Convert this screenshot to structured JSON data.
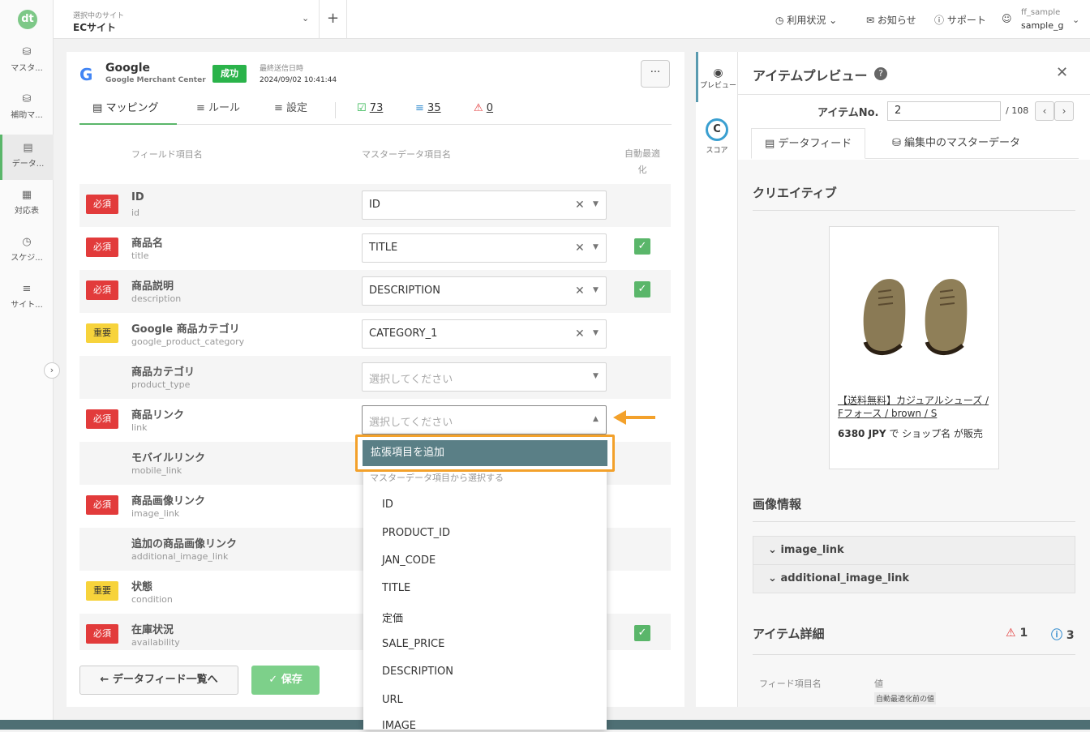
{
  "nav": {
    "logo": "dt",
    "items": [
      {
        "label": "マスタ...",
        "icon": "database-icon"
      },
      {
        "label": "補助マ...",
        "icon": "database-plus-icon"
      },
      {
        "label": "データ...",
        "icon": "document-icon"
      },
      {
        "label": "対応表",
        "icon": "table-icon"
      },
      {
        "label": "スケジ...",
        "icon": "calendar-clock-icon"
      },
      {
        "label": "サイト...",
        "icon": "sliders-icon"
      }
    ]
  },
  "topbar": {
    "site_caption": "選択中のサイト",
    "site_name": "ECサイト",
    "usage": "利用状況",
    "news": "お知らせ",
    "support": "サポート",
    "user_line1": "ff_sample",
    "user_line2": "sample_g"
  },
  "feed": {
    "name": "Google",
    "sub": "Google Merchant Center",
    "status": "成功",
    "sent_caption": "最終送信日時",
    "sent_value": "2024/09/02 10:41:44",
    "tabs": {
      "mapping": "マッピング",
      "rules": "ルール",
      "settings": "設定",
      "ok_count": "73",
      "error_count": "35",
      "warn_count": "0"
    },
    "col_feed": "フィールド項目名",
    "col_master": "マスターデータ項目名",
    "col_auto": "自動最適化",
    "rows": [
      {
        "badge": "必須",
        "name": "ID",
        "id": "id",
        "value": "ID"
      },
      {
        "badge": "必須",
        "name": "商品名",
        "id": "title",
        "value": "TITLE"
      },
      {
        "badge": "必須",
        "name": "商品説明",
        "id": "description",
        "value": "DESCRIPTION"
      },
      {
        "badge": "重要",
        "name": "Google 商品カテゴリ",
        "id": "google_product_category",
        "value": "CATEGORY_1"
      },
      {
        "badge": "",
        "name": "商品カテゴリ",
        "id": "product_type",
        "value": "選択してください"
      },
      {
        "badge": "必須",
        "name": "商品リンク",
        "id": "link",
        "value": "選択してください"
      },
      {
        "badge": "",
        "name": "モバイルリンク",
        "id": "mobile_link",
        "value": ""
      },
      {
        "badge": "必須",
        "name": "商品画像リンク",
        "id": "image_link",
        "value": ""
      },
      {
        "badge": "",
        "name": "追加の商品画像リンク",
        "id": "additional_image_link",
        "value": ""
      },
      {
        "badge": "重要",
        "name": "状態",
        "id": "condition",
        "value": ""
      },
      {
        "badge": "必須",
        "name": "在庫状況",
        "id": "availability",
        "value": ""
      }
    ],
    "back_label": "データフィード一覧へ",
    "save_label": "保存"
  },
  "dropdown": {
    "add_label": "拡張項目を追加",
    "group_label": "マスターデータ項目から選択する",
    "options": [
      "ID",
      "PRODUCT_ID",
      "JAN_CODE",
      "TITLE",
      "定価",
      "SALE_PRICE",
      "DESCRIPTION",
      "URL",
      "IMAGE"
    ]
  },
  "side": {
    "preview": "プレビュー",
    "score": "スコア",
    "score_letter": "C"
  },
  "preview": {
    "title": "アイテムプレビュー",
    "item_no_label": "アイテムNo.",
    "item_no": "2",
    "total": "/ 108",
    "tab_feed": "データフィード",
    "tab_master": "編集中のマスターデータ",
    "creative": "クリエイティブ",
    "product_link": "【送料無料】カジュアルシューズ / Fフォース / brown / S",
    "price": "6380 JPY",
    "price_rest": " で ショップ名 が販売",
    "image_info": "画像情報",
    "acc1": "image_link",
    "acc2": "additional_image_link",
    "item_detail": "アイテム詳細",
    "warn_count": "1",
    "info_count": "3",
    "th_field": "フィード項目名",
    "th_value": "値",
    "auto_tag": "自動最適化前の値"
  },
  "colors": {
    "accent": "#5ab66a",
    "required": "#e23b3b",
    "important": "#f7d33b",
    "highlight": "#f3a12b",
    "selected": "#5a7f86"
  }
}
